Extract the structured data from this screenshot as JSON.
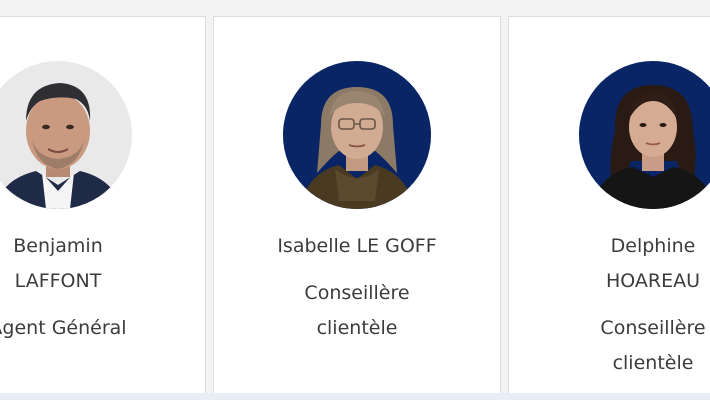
{
  "team": [
    {
      "name_line1": "Benjamin",
      "name_line2": "LAFFONT",
      "role_line1": "Agent Général",
      "role_line2": "",
      "photo": "portrait-man-light-background"
    },
    {
      "name_line1": "Isabelle LE GOFF",
      "name_line2": "",
      "role_line1": "Conseillère",
      "role_line2": "clientèle",
      "photo": "portrait-woman-blue-background"
    },
    {
      "name_line1": "Delphine",
      "name_line2": "HOAREAU",
      "role_line1": "Conseillère",
      "role_line2": "clientèle",
      "photo": "portrait-woman-blue-background"
    }
  ],
  "colors": {
    "page_background": "#f3f3f3",
    "card_background": "#ffffff",
    "card_border": "#dddddd",
    "text": "#3c3c3c",
    "photo_backdrop_blue": "#0b2a6f"
  }
}
